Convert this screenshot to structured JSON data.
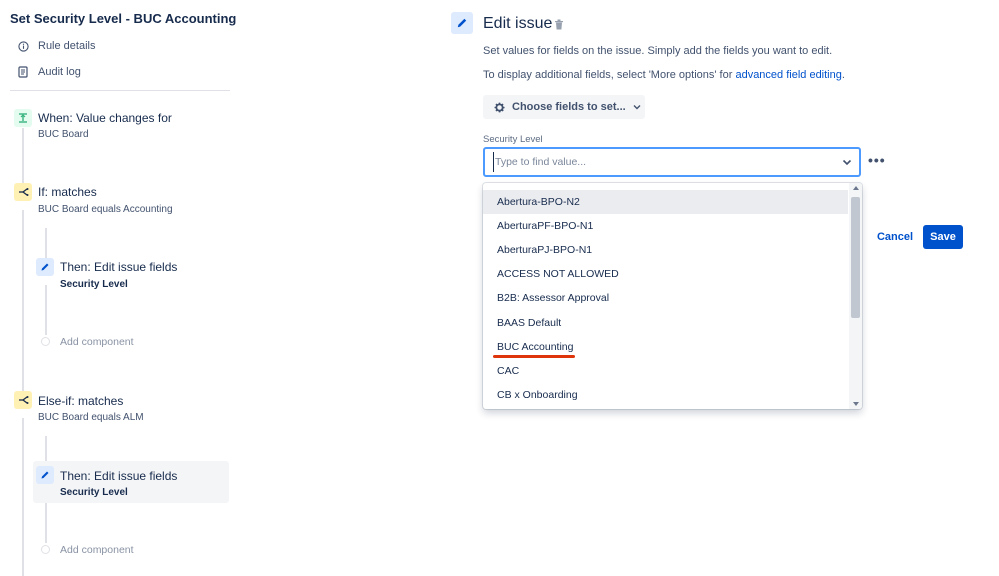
{
  "rule": {
    "title": "Set Security Level - BUC Accounting",
    "links": [
      {
        "label": "Rule details",
        "icon": "info-icon"
      },
      {
        "label": "Audit log",
        "icon": "document-icon"
      }
    ]
  },
  "flow": {
    "trigger": {
      "title": "When: Value changes for",
      "sub": "BUC Board",
      "icon": "trigger-icon",
      "color": "#36b37e"
    },
    "if": {
      "title": "If: matches",
      "sub": "BUC Board equals Accounting",
      "icon": "branch-icon",
      "color": "#ffc400"
    },
    "then1": {
      "title": "Then: Edit issue fields",
      "sub": "Security Level",
      "icon": "pencil-icon"
    },
    "add1": "Add component",
    "elseif": {
      "title": "Else-if: matches",
      "sub": "BUC Board equals ALM",
      "icon": "branch-icon",
      "color": "#ffc400"
    },
    "then2": {
      "title": "Then: Edit issue fields",
      "sub": "Security Level",
      "icon": "pencil-icon"
    },
    "add2": "Add component"
  },
  "editor": {
    "title": "Edit issue",
    "desc1": "Set values for fields on the issue. Simply add the fields you want to edit.",
    "desc2_prefix": "To display additional fields, select 'More options' for ",
    "desc2_link": "advanced field editing",
    "desc2_suffix": ".",
    "choose_label": "Choose fields to set...",
    "field_label": "Security Level",
    "search_placeholder": "Type to find value...",
    "options": [
      "Abertura-BPO-N2",
      "AberturaPF-BPO-N1",
      "AberturaPJ-BPO-N1",
      "ACCESS NOT ALLOWED",
      "B2B: Assessor Approval",
      "BAAS Default",
      "BUC Accounting",
      "CAC",
      "CB x Onboarding"
    ],
    "highlighted_option": "Abertura-BPO-N2",
    "cancel_label": "Cancel",
    "save_label": "Save",
    "more_label": "•••",
    "accent": "#0052cc"
  }
}
